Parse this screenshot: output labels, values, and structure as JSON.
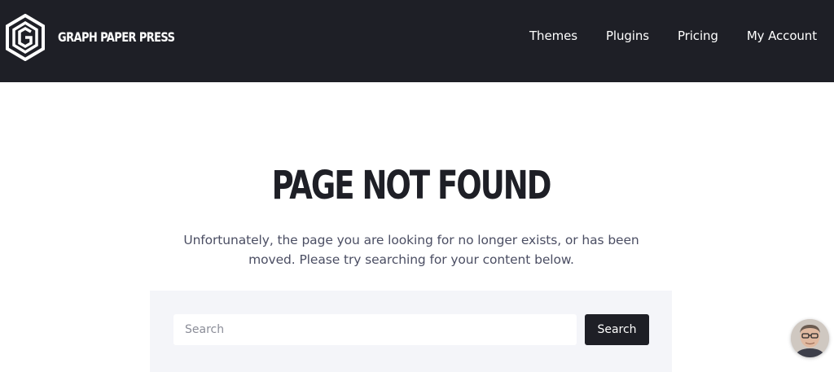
{
  "header": {
    "brand_name": "GRAPH PAPER PRESS",
    "logo_icon": "hexagon-g-logo-icon",
    "nav": [
      {
        "label": "Themes"
      },
      {
        "label": "Plugins"
      },
      {
        "label": "Pricing"
      },
      {
        "label": "My Account"
      }
    ]
  },
  "main": {
    "title": "PAGE NOT FOUND",
    "message": "Unfortunately, the page you are looking for no longer exists, or has been moved. Please try searching for your content below."
  },
  "search": {
    "placeholder": "Search",
    "value": "",
    "button_label": "Search"
  },
  "chat_widget": {
    "icon": "support-avatar-icon"
  },
  "colors": {
    "header_bg": "#1e1f26",
    "panel_bg": "#f4f5f9",
    "text_primary": "#1e1f26",
    "text_secondary": "#4b4e63"
  }
}
